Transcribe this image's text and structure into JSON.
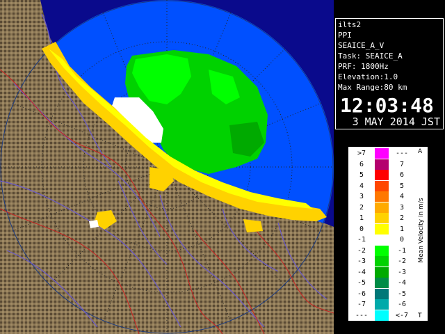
{
  "info": {
    "lines": [
      "ilts2",
      "PPI",
      "SEAICE_A_V",
      "Task: SEAICE_A",
      "PRF: 1800Hz",
      "Elevation:1.0",
      "Max Range:80 km"
    ],
    "time": "12:03:48",
    "date": "3 MAY 2014 JST"
  },
  "legend": {
    "title": "Mean Velocity in m/s",
    "top_marker": "A",
    "bottom_marker": "T",
    "rows": [
      {
        "lo": ">7",
        "hi": "---",
        "color": "#ff00ff"
      },
      {
        "lo": "6",
        "hi": "7",
        "color": "#b4006e"
      },
      {
        "lo": "5",
        "hi": "6",
        "color": "#ff0000"
      },
      {
        "lo": "4",
        "hi": "5",
        "color": "#ff4600"
      },
      {
        "lo": "3",
        "hi": "4",
        "color": "#ff7800"
      },
      {
        "lo": "2",
        "hi": "3",
        "color": "#ffaa00"
      },
      {
        "lo": "1",
        "hi": "2",
        "color": "#ffd200"
      },
      {
        "lo": "0",
        "hi": "1",
        "color": "#ffff00"
      },
      {
        "lo": "-1",
        "hi": "0",
        "color": "#ffffff"
      },
      {
        "lo": "-2",
        "hi": "-1",
        "color": "#00ff00"
      },
      {
        "lo": "-3",
        "hi": "-2",
        "color": "#00d200"
      },
      {
        "lo": "-4",
        "hi": "-3",
        "color": "#00aa00"
      },
      {
        "lo": "-5",
        "hi": "-4",
        "color": "#008c46"
      },
      {
        "lo": "-6",
        "hi": "-5",
        "color": "#007878"
      },
      {
        "lo": "-7",
        "hi": "-6",
        "color": "#00aaaa"
      },
      {
        "lo": "---",
        "hi": "<-7",
        "color": "#00ffff"
      }
    ]
  },
  "colors": {
    "sea": "#0050ff",
    "sea_dark": "#0a0a8c",
    "land": "#8a7654",
    "land_dark": "#3c3020",
    "river": "#6a5acd",
    "border": "#cc2020",
    "echo_main": "#00d200",
    "echo_light": "#00ff00",
    "echo_coast": "#ffd200",
    "echo_yellow": "#ffff00",
    "echo_white": "#ffffff"
  }
}
